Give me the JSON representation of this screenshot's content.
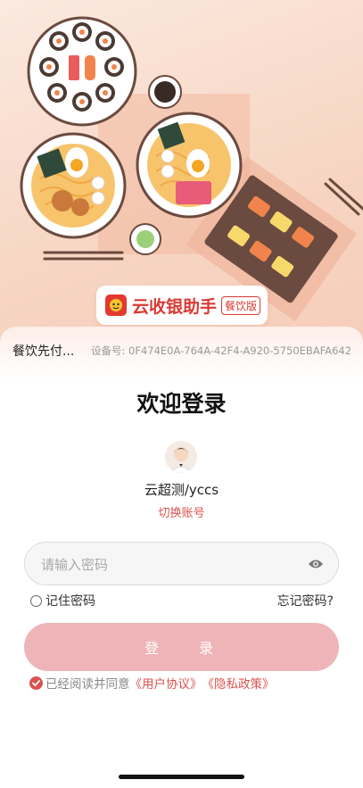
{
  "brand": {
    "name": "云收银助手",
    "tag": "餐饮版"
  },
  "store": {
    "name": "餐饮先付...",
    "device": "设备号: 0F474E0A-764A-42F4-A920-5750EBAFA642"
  },
  "login": {
    "title": "欢迎登录",
    "account": "云超测/yccs",
    "switch_account": "切换账号",
    "password_placeholder": "请输入密码",
    "remember_password": "记住密码",
    "remember_checked": false,
    "forgot_password": "忘记密码?",
    "login_button": "登 录"
  },
  "agreement": {
    "checked": true,
    "prefix": "已经阅读并同意",
    "user_agreement": "《用户协议》",
    "privacy_policy": "《隐私政策》"
  },
  "colors": {
    "accent": "#d9534f",
    "button": "#efb4b7",
    "hero": "#f7d6c4"
  },
  "icons": {
    "visibility": "eye-icon",
    "check": "check-icon",
    "logo": "brand-logo-icon"
  }
}
